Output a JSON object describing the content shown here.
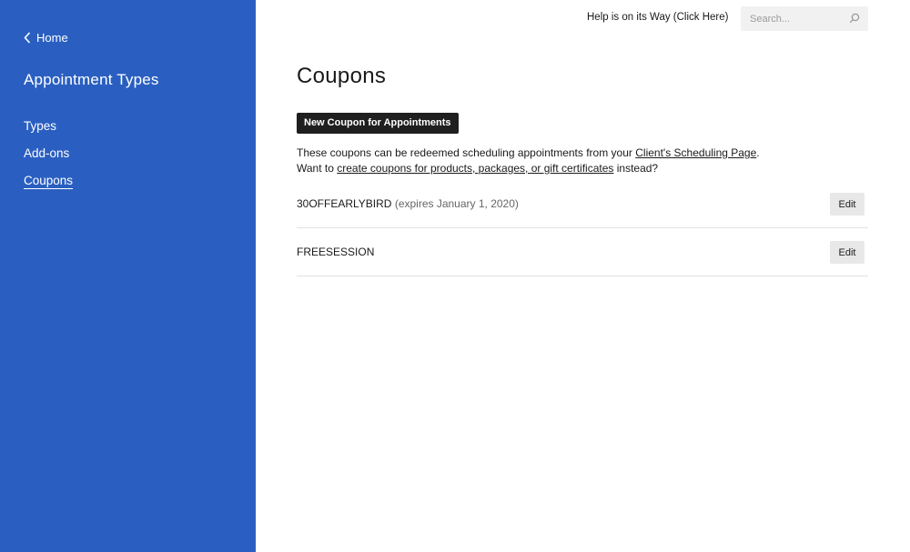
{
  "sidebar": {
    "home_label": "Home",
    "title": "Appointment Types",
    "items": [
      {
        "label": "Types"
      },
      {
        "label": "Add-ons"
      },
      {
        "label": "Coupons"
      }
    ],
    "active_item": "Coupons",
    "background_color": "#2a5fc1"
  },
  "header": {
    "help_label": "Help is on its Way (Click Here)",
    "search_placeholder": "Search..."
  },
  "main": {
    "title": "Coupons",
    "new_coupon_label": "New Coupon for Appointments",
    "description": {
      "line1_prefix": "These coupons can be redeemed scheduling appointments from your ",
      "line1_link": "Client's Scheduling Page",
      "line1_suffix": ".",
      "line2_prefix": "Want to ",
      "line2_link": "create coupons for products, packages, or gift certificates",
      "line2_suffix": " instead?"
    },
    "coupons": [
      {
        "code": "30OFFEARLYBIRD",
        "expiry": " (expires January 1, 2020)",
        "edit_label": "Edit"
      },
      {
        "code": "FREESESSION",
        "expiry": "",
        "edit_label": "Edit"
      }
    ]
  }
}
